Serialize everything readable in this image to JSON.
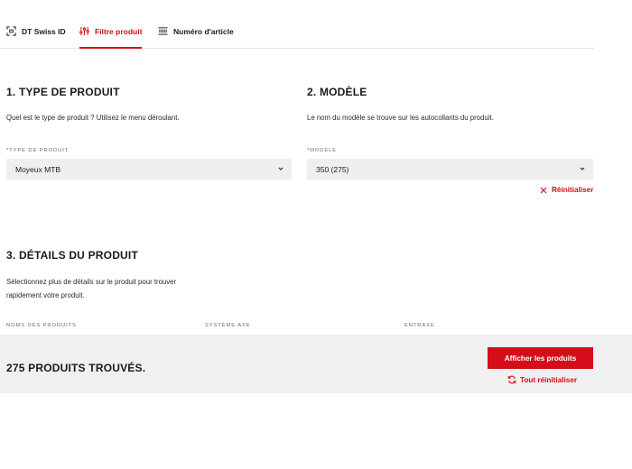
{
  "tabs": [
    {
      "label": "DT Swiss ID",
      "icon": "scan-id-icon",
      "active": false
    },
    {
      "label": "Filtre produit",
      "icon": "sliders-icon",
      "active": true
    },
    {
      "label": "Numéro d'article",
      "icon": "barcode-icon",
      "active": false
    }
  ],
  "section1": {
    "title": "1. TYPE DE PRODUIT",
    "description": "Quel est le type de produit ? Utilisez le menu déroulant.",
    "field_label": "*TYPE DE PRODUIT",
    "selected": "Moyeux MTB"
  },
  "section2": {
    "title": "2. MODÈLE",
    "description": "Le nom du modèle se trouve sur les autocollants du produit.",
    "field_label": "*MODÈLE",
    "selected": "350 (275)",
    "reset_label": "Réinitialiser"
  },
  "section3": {
    "title": "3. DÉTAILS DU PRODUIT",
    "description_line1": "Sélectionnez plus de détails sur le produit pour trouver",
    "description_line2": "rapidement votre produit.",
    "columns": [
      "NOMS DES PRODUITS",
      "SYSTÈME AXE",
      "ENTRAXE"
    ]
  },
  "footer": {
    "found_text": "275 PRODUITS TROUVÉS.",
    "primary_button": "Afficher les produits",
    "reset_all": "Tout réinitialiser"
  },
  "colors": {
    "accent": "#d50c1a",
    "field_bg": "#efefef",
    "footer_bg": "#f0f0f0"
  }
}
